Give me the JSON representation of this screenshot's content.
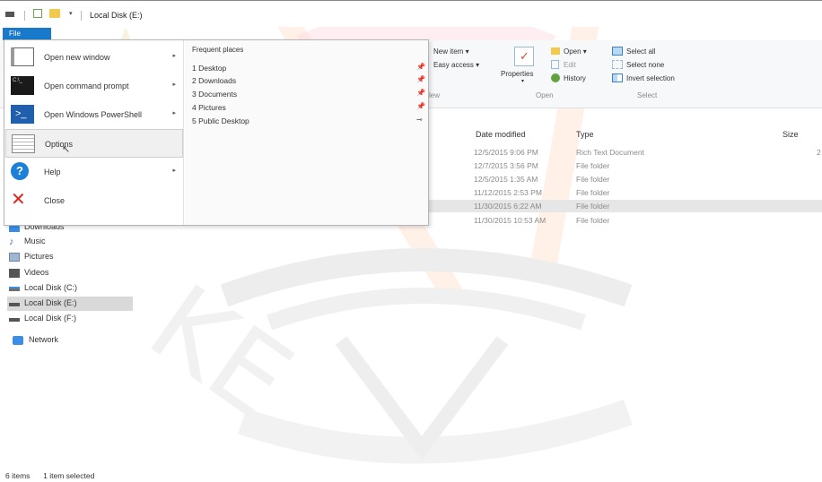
{
  "window": {
    "title": "Local Disk (E:)"
  },
  "file_tab": {
    "label": "File"
  },
  "ribbon": {
    "new_item": "New item ▾",
    "easy_access": "Easy access ▾",
    "new_group_label": "lew",
    "properties": "Properties",
    "open": "Open ▾",
    "edit": "Edit",
    "history": "History",
    "open_group_label": "Open",
    "select_all": "Select all",
    "select_none": "Select none",
    "invert_selection": "Invert selection",
    "select_group_label": "Select"
  },
  "columns": {
    "date_modified": "Date modified",
    "type": "Type",
    "size": "Size"
  },
  "rows": [
    {
      "date": "12/5/2015 9:06 PM",
      "type": "Rich Text Document",
      "size": "2"
    },
    {
      "date": "12/7/2015 3:56 PM",
      "type": "File folder",
      "size": ""
    },
    {
      "date": "12/5/2015 1:35 AM",
      "type": "File folder",
      "size": ""
    },
    {
      "date": "11/12/2015 2:53 PM",
      "type": "File folder",
      "size": ""
    },
    {
      "date": "11/30/2015 6:22 AM",
      "type": "File folder",
      "size": ""
    },
    {
      "date": "11/30/2015 10:53 AM",
      "type": "File folder",
      "size": ""
    }
  ],
  "nav": {
    "downloads": "Downloads",
    "music": "Music",
    "pictures": "Pictures",
    "videos": "Videos",
    "disk_c": "Local Disk (C:)",
    "disk_e": "Local Disk (E:)",
    "disk_f": "Local Disk (F:)",
    "network": "Network"
  },
  "file_menu": {
    "open_new_window": "Open new window",
    "open_command_prompt": "Open command prompt",
    "open_powershell": "Open Windows PowerShell",
    "options": "Options",
    "help": "Help",
    "close": "Close",
    "frequent_places_heading": "Frequent places",
    "frequent_places": [
      "1  Desktop",
      "2  Downloads",
      "3  Documents",
      "4  Pictures",
      "5  Public Desktop"
    ]
  },
  "status": {
    "items": "6 items",
    "selected": "1 item selected"
  },
  "colors": {
    "file_tab": "#1979ca",
    "help_icon": "#1c7fd8",
    "close_icon": "#e1251b",
    "powershell_icon": "#1f5fae"
  }
}
